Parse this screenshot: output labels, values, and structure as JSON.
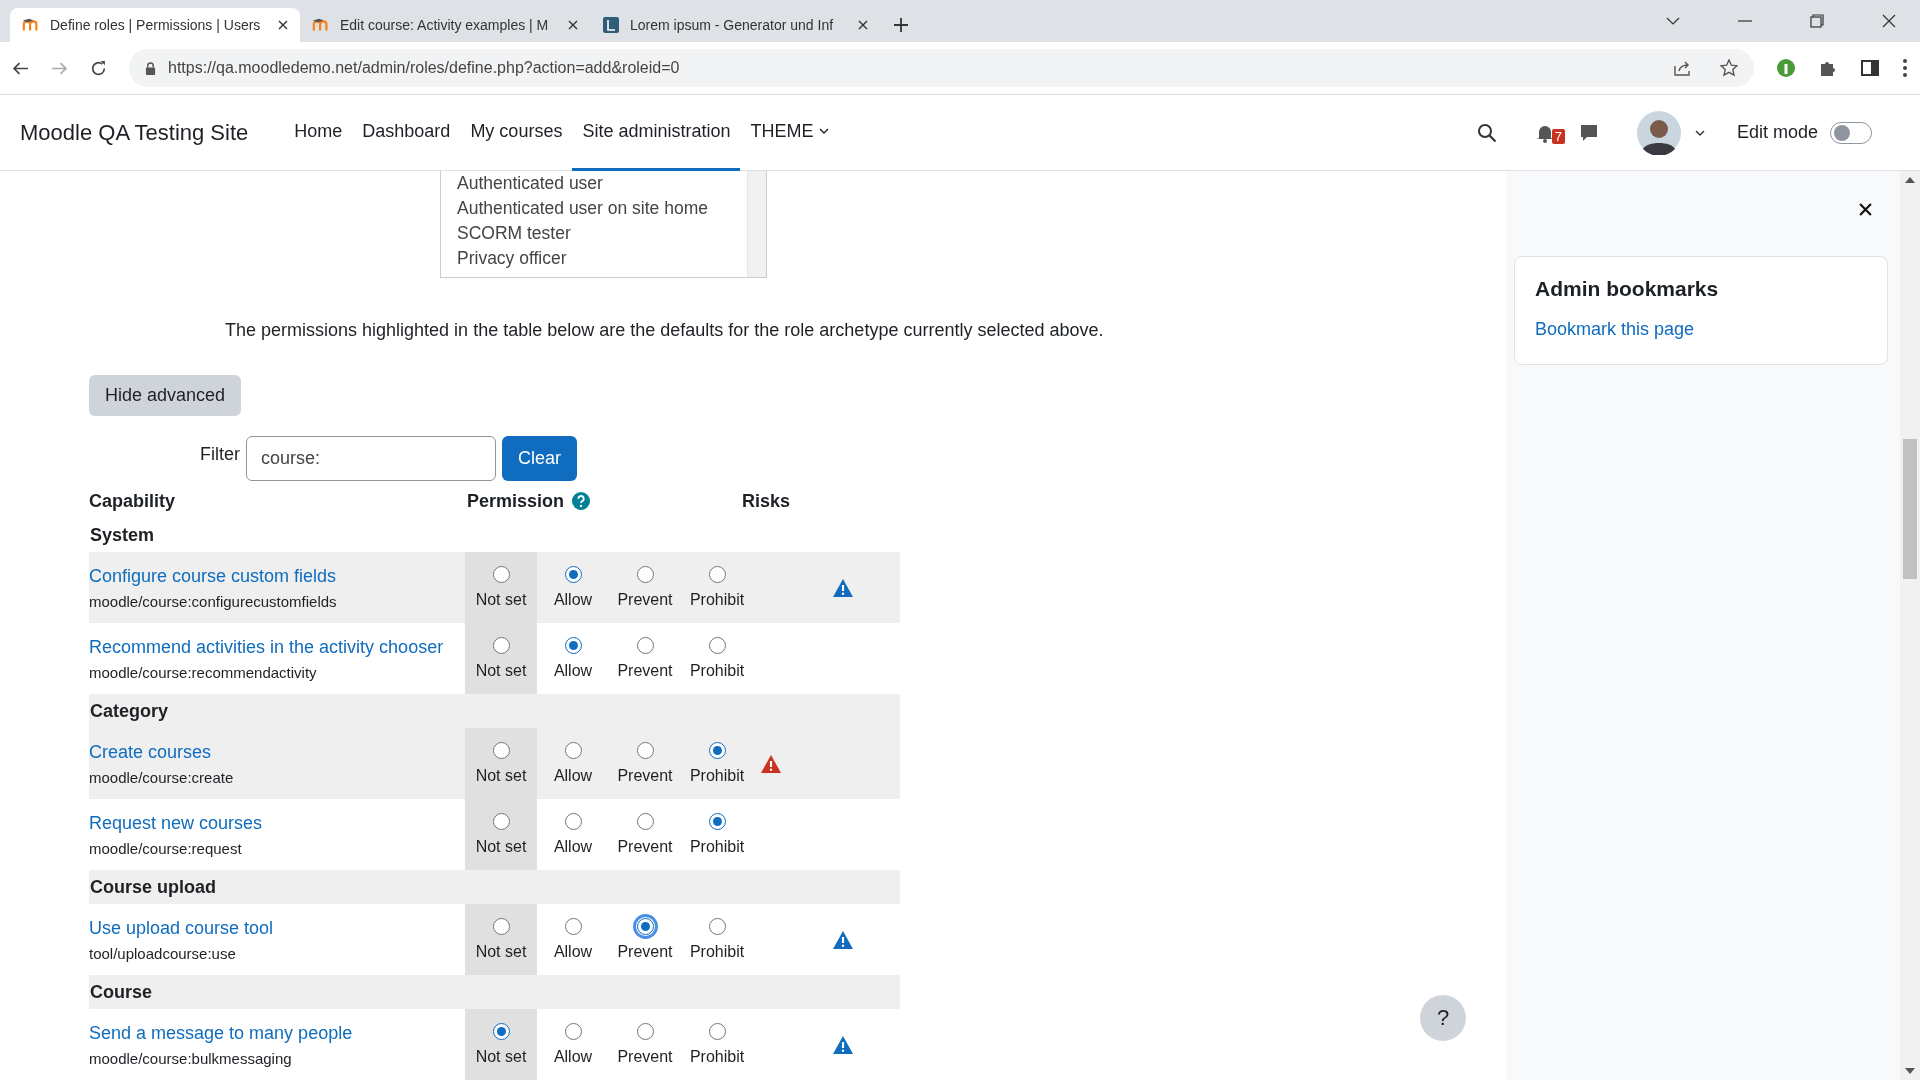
{
  "browser": {
    "tabs": [
      {
        "title": "Define roles | Permissions | Users",
        "selected": true,
        "kind": "moodle"
      },
      {
        "title": "Edit course: Activity examples | M",
        "selected": false,
        "kind": "moodle"
      },
      {
        "title": "Lorem ipsum - Generator und Inf",
        "selected": false,
        "kind": "letter"
      }
    ],
    "url": "https://qa.moodledemo.net/admin/roles/define.php?action=add&roleid=0"
  },
  "navbar": {
    "site_name": "Moodle QA Testing Site",
    "items": [
      {
        "label": "Home",
        "selected": false,
        "dropdown": false
      },
      {
        "label": "Dashboard",
        "selected": false,
        "dropdown": false
      },
      {
        "label": "My courses",
        "selected": false,
        "dropdown": false
      },
      {
        "label": "Site administration",
        "selected": true,
        "dropdown": false
      },
      {
        "label": "THEME",
        "selected": false,
        "dropdown": true
      }
    ],
    "notification_count": "7",
    "edit_mode": {
      "label": "Edit mode",
      "on": false
    }
  },
  "archetype_list": [
    "Authenticated user",
    "Authenticated user on site home",
    "SCORM tester",
    "Privacy officer"
  ],
  "description": "The permissions highlighted in the table below are the defaults for the role archetype currently selected above.",
  "hide_advanced_button": "Hide advanced",
  "filter": {
    "label": "Filter",
    "value": "course:",
    "clear_button": "Clear"
  },
  "table": {
    "columns": [
      "Capability",
      "Permission",
      "Risks"
    ],
    "groups": [
      {
        "name": "System",
        "rows": [
          {
            "title": "Configure course custom fields",
            "code": "moodle/course:configurecustomfields",
            "striped": true,
            "options": [
              {
                "label": "Not set",
                "selected": false,
                "highlighted": true,
                "focused": false
              },
              {
                "label": "Allow",
                "selected": true,
                "highlighted": false,
                "focused": false
              },
              {
                "label": "Prevent",
                "selected": false,
                "highlighted": false,
                "focused": false
              },
              {
                "label": "Prohibit",
                "selected": false,
                "highlighted": false,
                "focused": false
              }
            ],
            "risks": [
              {
                "on": false
              },
              {
                "on": false
              },
              {
                "on": true,
                "color": "#0f6cbf"
              },
              {
                "on": false
              }
            ]
          },
          {
            "title": "Recommend activities in the activity chooser",
            "code": "moodle/course:recommendactivity",
            "striped": false,
            "options": [
              {
                "label": "Not set",
                "selected": false,
                "highlighted": true,
                "focused": false
              },
              {
                "label": "Allow",
                "selected": true,
                "highlighted": false,
                "focused": false
              },
              {
                "label": "Prevent",
                "selected": false,
                "highlighted": false,
                "focused": false
              },
              {
                "label": "Prohibit",
                "selected": false,
                "highlighted": false,
                "focused": false
              }
            ],
            "risks": [
              {
                "on": false
              },
              {
                "on": false
              },
              {
                "on": false
              },
              {
                "on": false
              }
            ]
          }
        ]
      },
      {
        "name": "Category",
        "rows": [
          {
            "title": "Create courses",
            "code": "moodle/course:create",
            "striped": true,
            "options": [
              {
                "label": "Not set",
                "selected": false,
                "highlighted": true,
                "focused": false
              },
              {
                "label": "Allow",
                "selected": false,
                "highlighted": false,
                "focused": false
              },
              {
                "label": "Prevent",
                "selected": false,
                "highlighted": false,
                "focused": false
              },
              {
                "label": "Prohibit",
                "selected": true,
                "highlighted": false,
                "focused": false
              }
            ],
            "risks": [
              {
                "on": true,
                "color": "#ca3120"
              },
              {
                "on": false
              },
              {
                "on": false
              },
              {
                "on": false
              }
            ]
          },
          {
            "title": "Request new courses",
            "code": "moodle/course:request",
            "striped": false,
            "options": [
              {
                "label": "Not set",
                "selected": false,
                "highlighted": true,
                "focused": false
              },
              {
                "label": "Allow",
                "selected": false,
                "highlighted": false,
                "focused": false
              },
              {
                "label": "Prevent",
                "selected": false,
                "highlighted": false,
                "focused": false
              },
              {
                "label": "Prohibit",
                "selected": true,
                "highlighted": false,
                "focused": false
              }
            ],
            "risks": [
              {
                "on": false
              },
              {
                "on": false
              },
              {
                "on": false
              },
              {
                "on": false
              }
            ]
          }
        ]
      },
      {
        "name": "Course upload",
        "rows": [
          {
            "title": "Use upload course tool",
            "code": "tool/uploadcourse:use",
            "striped": false,
            "options": [
              {
                "label": "Not set",
                "selected": false,
                "highlighted": true,
                "focused": false
              },
              {
                "label": "Allow",
                "selected": false,
                "highlighted": false,
                "focused": false
              },
              {
                "label": "Prevent",
                "selected": true,
                "highlighted": false,
                "focused": true
              },
              {
                "label": "Prohibit",
                "selected": false,
                "highlighted": false,
                "focused": false
              }
            ],
            "risks": [
              {
                "on": false
              },
              {
                "on": false
              },
              {
                "on": true,
                "color": "#0f6cbf"
              },
              {
                "on": false
              }
            ]
          }
        ]
      },
      {
        "name": "Course",
        "rows": [
          {
            "title": "Send a message to many people",
            "code": "moodle/course:bulkmessaging",
            "striped": false,
            "options": [
              {
                "label": "Not set",
                "selected": true,
                "highlighted": true,
                "focused": false
              },
              {
                "label": "Allow",
                "selected": false,
                "highlighted": false,
                "focused": false
              },
              {
                "label": "Prevent",
                "selected": false,
                "highlighted": false,
                "focused": false
              },
              {
                "label": "Prohibit",
                "selected": false,
                "highlighted": false,
                "focused": false
              }
            ],
            "risks": [
              {
                "on": false
              },
              {
                "on": false
              },
              {
                "on": true,
                "color": "#0f6cbf"
              },
              {
                "on": false
              }
            ]
          }
        ]
      }
    ]
  },
  "drawer": {
    "block_title": "Admin bookmarks",
    "link": "Bookmark this page"
  },
  "help_button": "?"
}
